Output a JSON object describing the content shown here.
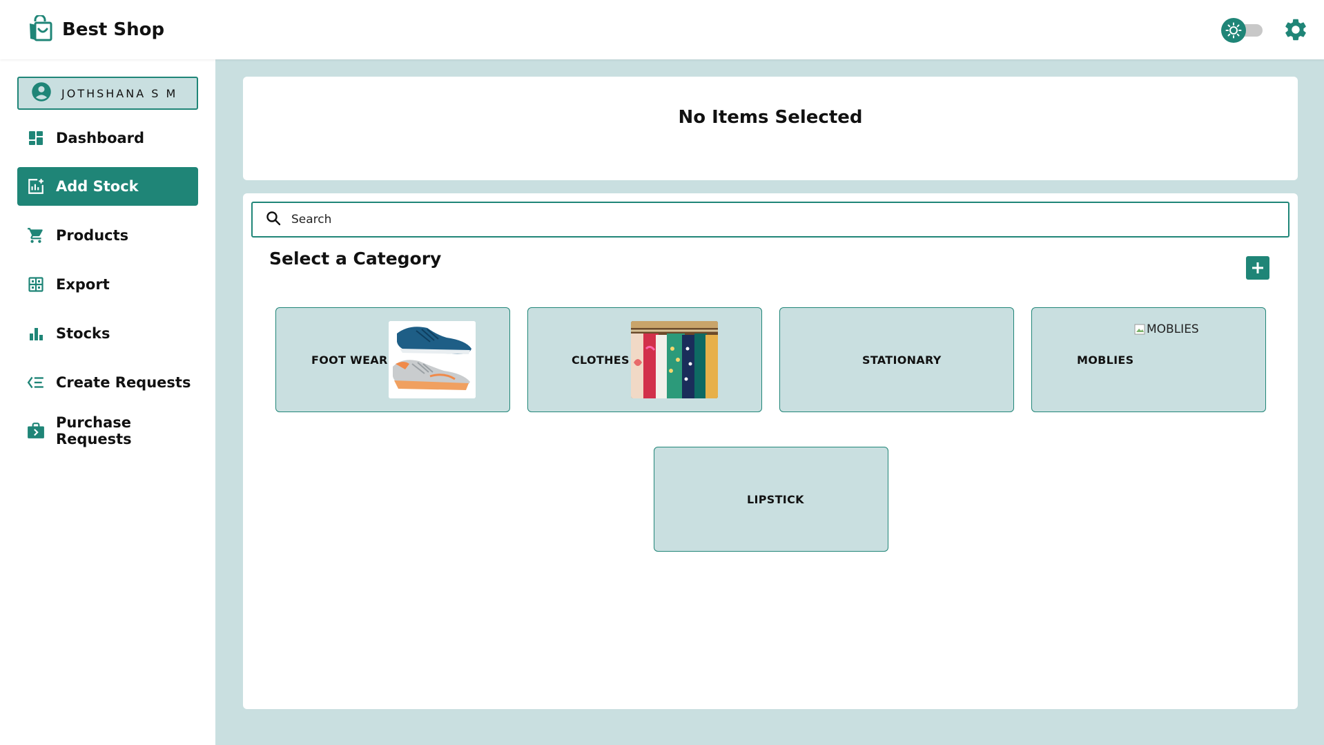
{
  "header": {
    "brand_name": "Best Shop"
  },
  "user": {
    "name": "JOTHSHANA S M"
  },
  "sidebar": {
    "items": [
      {
        "label": "Dashboard",
        "icon": "dashboard-icon"
      },
      {
        "label": "Add Stock",
        "icon": "add-chart-icon",
        "active": true
      },
      {
        "label": "Products",
        "icon": "cart-icon"
      },
      {
        "label": "Export",
        "icon": "grid-icon"
      },
      {
        "label": "Stocks",
        "icon": "bar-chart-icon"
      },
      {
        "label": "Create Requests",
        "icon": "list-add-icon"
      },
      {
        "label": "Purchase Requests",
        "icon": "bag-icon"
      }
    ]
  },
  "main": {
    "selected_title": "No Items Selected",
    "search_placeholder": "Search",
    "section_title": "Select a Category",
    "categories": [
      {
        "label": "FOOT WEAR",
        "image": "shoes"
      },
      {
        "label": "CLOTHES",
        "image": "clothes-rack"
      },
      {
        "label": "STATIONARY",
        "image": null
      },
      {
        "label": "MOBLIES",
        "image_alt": "MOBLIES"
      },
      {
        "label": "LIPSTICK",
        "image": null
      }
    ]
  },
  "colors": {
    "accent": "#1f8577",
    "background": "#c9dfe0",
    "surface": "#ffffff"
  }
}
